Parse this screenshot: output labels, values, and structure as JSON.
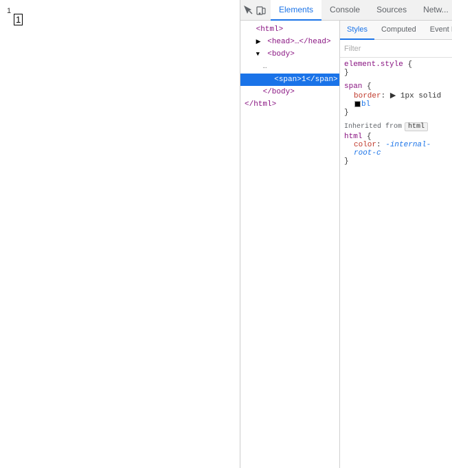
{
  "webpage": {
    "page_number": "1",
    "span_content": "1"
  },
  "devtools": {
    "toolbar": {
      "inspect_icon": "⬚",
      "device_icon": "⬜"
    },
    "main_tabs": [
      {
        "label": "Elements",
        "active": true
      },
      {
        "label": "Console",
        "active": false
      },
      {
        "label": "Sources",
        "active": false
      },
      {
        "label": "Netw...",
        "active": false
      }
    ],
    "elements_tree": [
      {
        "indent": 0,
        "triangle": "",
        "content": "<html>",
        "selected": false,
        "id": "html"
      },
      {
        "indent": 1,
        "triangle": "▶",
        "content": "<head>…</head>",
        "selected": false,
        "id": "head"
      },
      {
        "indent": 1,
        "triangle": "▼",
        "content": "<body>",
        "selected": false,
        "id": "body"
      },
      {
        "indent": 2,
        "triangle": "",
        "content": "…",
        "selected": false,
        "id": "dots",
        "is_dots": true
      },
      {
        "indent": 2,
        "triangle": "",
        "content": "<span>1</span>",
        "selected": true,
        "id": "span"
      },
      {
        "indent": 2,
        "triangle": "",
        "content": "</body>",
        "selected": false,
        "id": "body-close"
      },
      {
        "indent": 0,
        "triangle": "",
        "content": "</html>",
        "selected": false,
        "id": "html-close"
      }
    ],
    "styles_tabs": [
      {
        "label": "Styles",
        "active": true
      },
      {
        "label": "Computed",
        "active": false
      },
      {
        "label": "Event L...",
        "active": false
      }
    ],
    "filter_placeholder": "Filter",
    "css_rules": [
      {
        "selector": "element.style",
        "properties": [],
        "open_only": true
      },
      {
        "selector": "span",
        "properties": [
          {
            "name": "border",
            "value": "1px solid",
            "has_swatch": true,
            "swatch_color": "#000000"
          }
        ]
      }
    ],
    "inherited_section": {
      "label": "Inherited from",
      "tag": "html",
      "rules": [
        {
          "selector": "html",
          "properties": [
            {
              "name": "color",
              "value": "-internal-root-c",
              "italic": true
            }
          ]
        }
      ]
    }
  }
}
